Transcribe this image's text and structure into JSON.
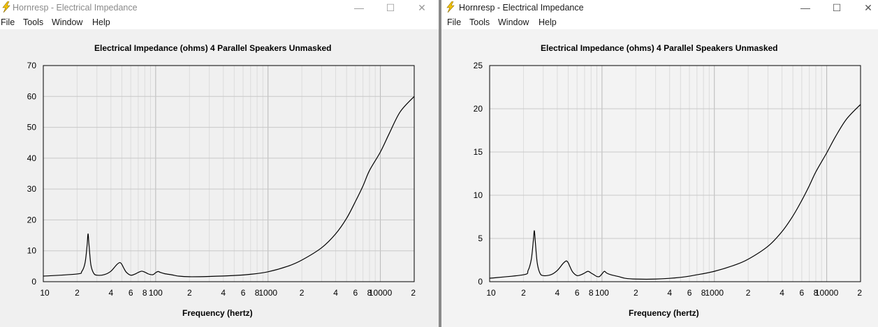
{
  "windows": [
    {
      "title": "Hornresp - Electrical Impedance",
      "menu": [
        "File",
        "Tools",
        "Window",
        "Help"
      ],
      "controls": [
        "—",
        "☐",
        "✕"
      ]
    },
    {
      "title": "Hornresp - Electrical Impedance",
      "menu": [
        "File",
        "Tools",
        "Window",
        "Help"
      ],
      "controls": [
        "—",
        "☐",
        "✕"
      ]
    }
  ],
  "colors": {
    "accent_icon": "#f5c400",
    "grid": "#c8c8c8",
    "curve": "#000000"
  },
  "chart_data": [
    {
      "type": "line",
      "title": "Electrical Impedance (ohms)   4 Parallel Speakers   Unmasked",
      "xlabel": "Frequency (hertz)",
      "ylabel": "",
      "xscale": "log",
      "xlim": [
        10,
        20000
      ],
      "ylim": [
        0,
        70
      ],
      "yticks": [
        0,
        10,
        20,
        30,
        40,
        50,
        60,
        70
      ],
      "xtick_labels": [
        "10",
        "2",
        "4",
        "6",
        "8",
        "100",
        "2",
        "4",
        "6",
        "8",
        "1000",
        "2",
        "4",
        "6",
        "8",
        "10000",
        "2"
      ],
      "grid": true,
      "series": [
        {
          "x": [
            10,
            20,
            22,
            23.5,
            24.5,
            25,
            25.5,
            26.5,
            28,
            30,
            35,
            40,
            45,
            48,
            50,
            52,
            55,
            60,
            65,
            70,
            75,
            80,
            85,
            90,
            95,
            100,
            105,
            110,
            120,
            140,
            160,
            200,
            300,
            500,
            700,
            1000,
            1500,
            2000,
            3000,
            4000,
            5000,
            6000,
            7000,
            8000,
            10000,
            12000,
            15000,
            20000
          ],
          "y": [
            1.8,
            2.5,
            3.3,
            6.0,
            11.5,
            15.5,
            12.0,
            5.5,
            2.8,
            2.1,
            2.3,
            3.4,
            5.5,
            6.2,
            5.6,
            4.4,
            3.0,
            2.1,
            2.4,
            3.0,
            3.4,
            3.1,
            2.6,
            2.3,
            2.3,
            2.9,
            3.3,
            3.0,
            2.6,
            2.2,
            1.8,
            1.6,
            1.7,
            2.0,
            2.4,
            3.2,
            5.0,
            7.0,
            11.0,
            15.5,
            20.5,
            26.0,
            31.0,
            36.0,
            42.0,
            48.0,
            55.0,
            60.0
          ]
        }
      ]
    },
    {
      "type": "line",
      "title": "Electrical Impedance (ohms)   4 Parallel Speakers   Unmasked",
      "xlabel": "Frequency (hertz)",
      "ylabel": "",
      "xscale": "log",
      "xlim": [
        10,
        20000
      ],
      "ylim": [
        0,
        25
      ],
      "yticks": [
        0,
        5,
        10,
        15,
        20,
        25
      ],
      "xtick_labels": [
        "10",
        "2",
        "4",
        "6",
        "8",
        "100",
        "2",
        "4",
        "6",
        "8",
        "1000",
        "2",
        "4",
        "6",
        "8",
        "10000",
        "2"
      ],
      "grid": true,
      "series": [
        {
          "x": [
            10,
            20,
            22,
            23.5,
            24.5,
            25,
            25.5,
            26.5,
            28,
            30,
            35,
            40,
            45,
            48,
            50,
            52,
            55,
            60,
            65,
            70,
            75,
            80,
            85,
            90,
            95,
            100,
            105,
            110,
            120,
            140,
            160,
            200,
            300,
            500,
            700,
            1000,
            1500,
            2000,
            3000,
            4000,
            5000,
            6000,
            7000,
            8000,
            10000,
            12000,
            15000,
            20000
          ],
          "y": [
            0.4,
            0.8,
            1.3,
            2.6,
            4.8,
            5.9,
            4.6,
            2.2,
            1.0,
            0.7,
            0.8,
            1.3,
            2.1,
            2.4,
            2.2,
            1.7,
            1.1,
            0.7,
            0.8,
            1.0,
            1.2,
            1.0,
            0.8,
            0.6,
            0.6,
            0.9,
            1.2,
            1.0,
            0.8,
            0.6,
            0.4,
            0.3,
            0.3,
            0.5,
            0.8,
            1.2,
            1.9,
            2.6,
            4.1,
            5.8,
            7.6,
            9.4,
            11.1,
            12.7,
            14.9,
            16.8,
            18.8,
            20.5
          ]
        }
      ]
    }
  ]
}
